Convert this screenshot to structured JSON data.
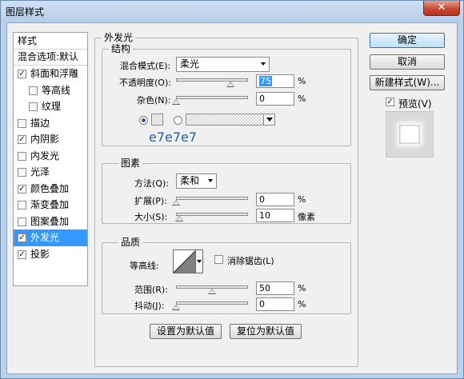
{
  "window": {
    "title": "图层样式",
    "close_glyph": "✕"
  },
  "styles_list": {
    "header": "样式",
    "blend_options": "混合选项:默认",
    "items": [
      {
        "label": "斜面和浮雕",
        "checked": true,
        "sub": false
      },
      {
        "label": "等高线",
        "checked": false,
        "sub": true
      },
      {
        "label": "纹理",
        "checked": false,
        "sub": true
      },
      {
        "label": "描边",
        "checked": false,
        "sub": false
      },
      {
        "label": "内阴影",
        "checked": true,
        "sub": false
      },
      {
        "label": "内发光",
        "checked": false,
        "sub": false
      },
      {
        "label": "光泽",
        "checked": false,
        "sub": false
      },
      {
        "label": "颜色叠加",
        "checked": true,
        "sub": false
      },
      {
        "label": "渐变叠加",
        "checked": false,
        "sub": false
      },
      {
        "label": "图案叠加",
        "checked": false,
        "sub": false
      },
      {
        "label": "外发光",
        "checked": true,
        "sub": false,
        "selected": true
      },
      {
        "label": "投影",
        "checked": true,
        "sub": false
      }
    ]
  },
  "outer_glow": {
    "title": "外发光",
    "structure": {
      "title": "结构",
      "blend_mode_label": "混合模式(E):",
      "blend_mode_value": "柔光",
      "opacity_label": "不透明度(O):",
      "opacity_value": "75",
      "opacity_unit": "%",
      "opacity_fraction": 0.75,
      "noise_label": "杂色(N):",
      "noise_value": "0",
      "noise_unit": "%",
      "noise_fraction": 0,
      "color_annotation": "e7e7e7"
    },
    "elements": {
      "title": "图素",
      "technique_label": "方法(Q):",
      "technique_value": "柔和",
      "spread_label": "扩展(P):",
      "spread_value": "0",
      "spread_unit": "%",
      "spread_fraction": 0,
      "size_label": "大小(S):",
      "size_value": "10",
      "size_unit": "像素",
      "size_fraction": 0.04
    },
    "quality": {
      "title": "品质",
      "contour_label": "等高线:",
      "antialias_label": "消除锯齿(L)",
      "antialias_checked": false,
      "range_label": "范围(R):",
      "range_value": "50",
      "range_unit": "%",
      "range_fraction": 0.5,
      "jitter_label": "抖动(J):",
      "jitter_value": "0",
      "jitter_unit": "%",
      "jitter_fraction": 0
    },
    "buttons": {
      "make_default": "设置为默认值",
      "reset_default": "复位为默认值"
    }
  },
  "side_buttons": {
    "ok": "确定",
    "cancel": "取消",
    "new_style": "新建样式(W)...",
    "preview_label": "预览(V)",
    "preview_checked": true
  },
  "colors": {
    "accent": "#3399ff",
    "annotation": "#2b5fa4",
    "glow": "#e7e7e7"
  }
}
